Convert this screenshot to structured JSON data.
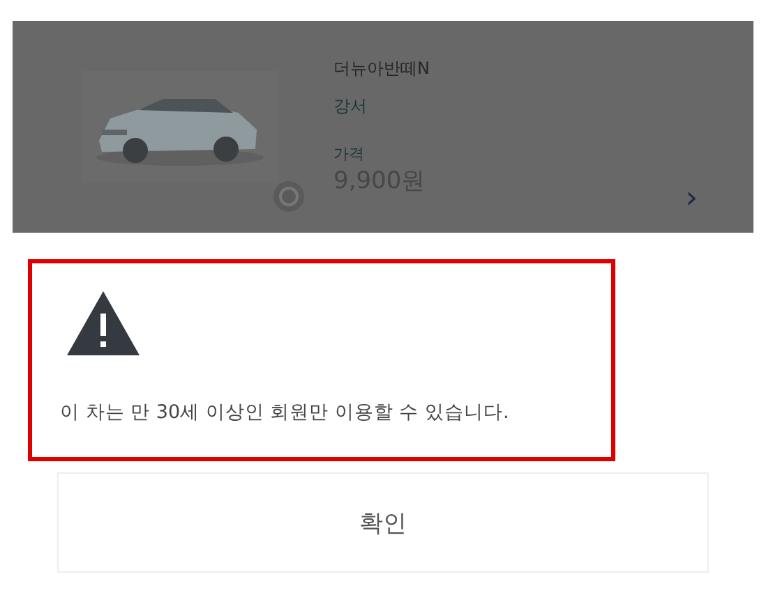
{
  "car_card": {
    "dimmed": true,
    "name": "더뉴아반떼N",
    "area": "강서",
    "price_label": "가격",
    "price": "9,900원",
    "chevron": "›"
  },
  "alert": {
    "highlighted": true,
    "message": "이 차는 만 30세 이상인 회원만 이용할 수 있습니다."
  },
  "buttons": [
    "확인"
  ]
}
